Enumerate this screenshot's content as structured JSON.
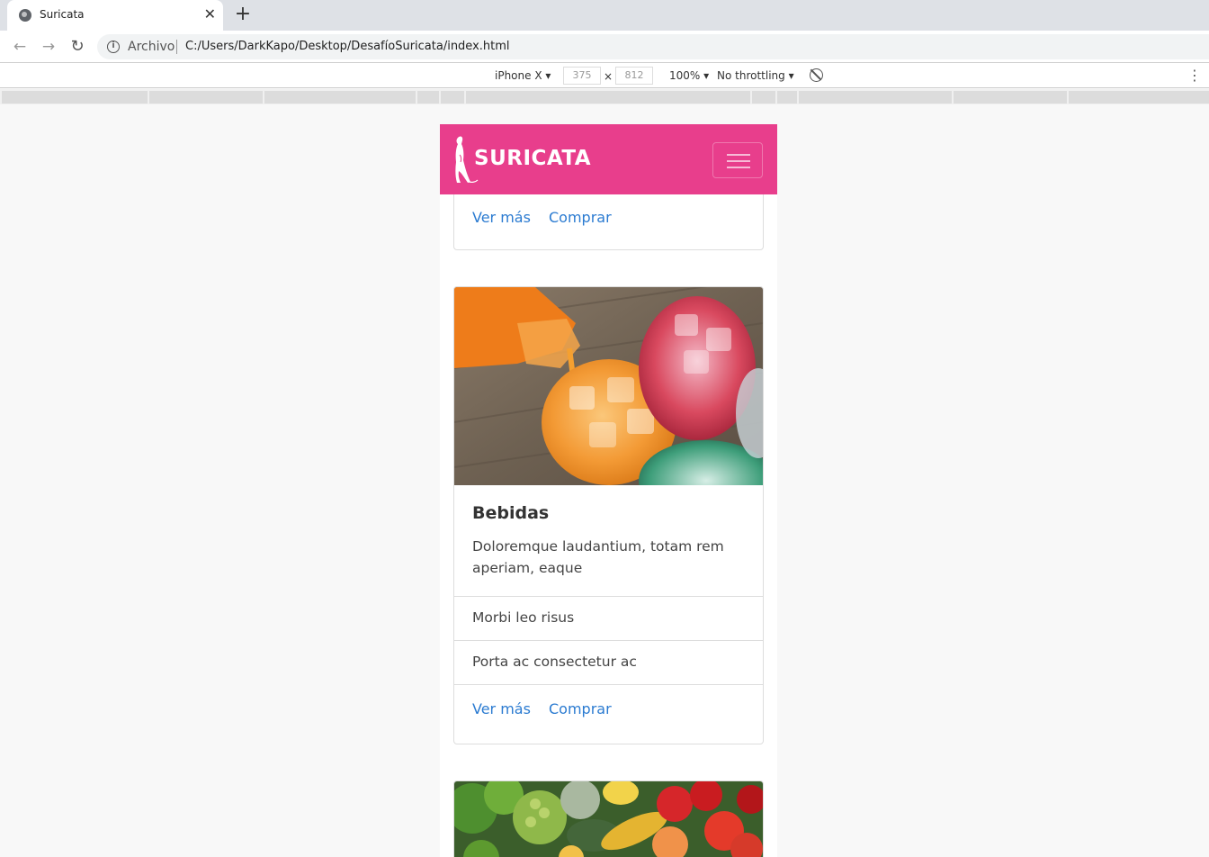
{
  "browser": {
    "tab_title": "Suricata",
    "tab_close": "✕",
    "new_tab": "+",
    "back": "←",
    "forward": "→",
    "reload": "↻",
    "info": "i",
    "protocol_label": "Archivo",
    "url": "C:/Users/DarkKapo/Desktop/DesafíoSuricata/index.html"
  },
  "device_toolbar": {
    "device": "iPhone X ▾",
    "width": "375",
    "times": "×",
    "height": "812",
    "zoom": "100% ▾",
    "throttling": "No throttling ▾",
    "menu": "⋮"
  },
  "site": {
    "brand": "SURICATA",
    "colors": {
      "navbar": "#e83e8c",
      "link": "#2b7bd1"
    },
    "top_card": {
      "link_more": "Ver más",
      "link_buy": "Comprar"
    },
    "card": {
      "title": "Bebidas",
      "text": "Doloremque laudantium, totam rem aperiam, eaque",
      "items": [
        "Morbi leo risus",
        "Porta ac consectetur ac"
      ],
      "link_more": "Ver más",
      "link_buy": "Comprar"
    }
  }
}
